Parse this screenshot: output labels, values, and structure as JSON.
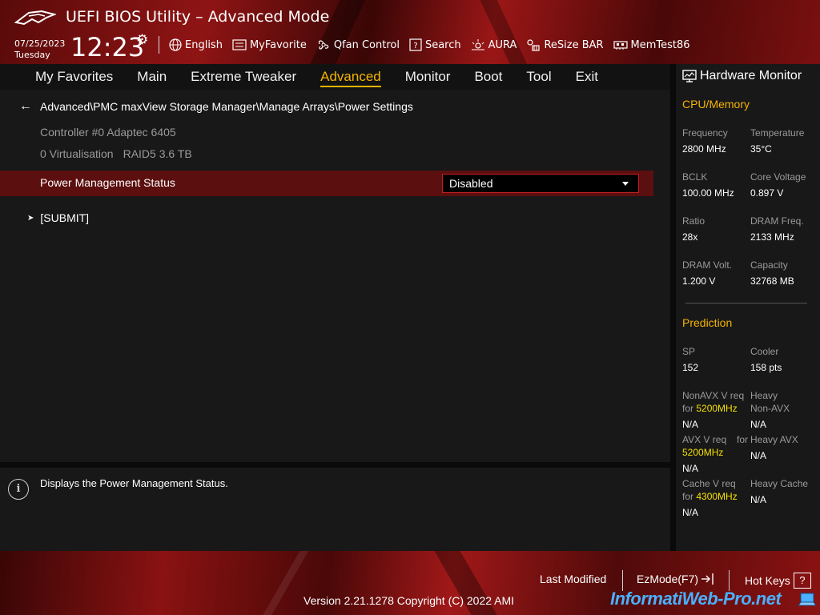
{
  "header": {
    "title": "UEFI BIOS Utility – Advanced Mode",
    "date": "07/25/2023",
    "day": "Tuesday",
    "time": "12:23",
    "tools": [
      {
        "label": "English",
        "icon": "globe-icon"
      },
      {
        "label": "MyFavorite",
        "icon": "favorite-icon"
      },
      {
        "label": "Qfan Control",
        "icon": "fan-icon"
      },
      {
        "label": "Search",
        "icon": "search-icon"
      },
      {
        "label": "AURA",
        "icon": "aura-icon"
      },
      {
        "label": "ReSize BAR",
        "icon": "resize-bar-icon"
      },
      {
        "label": "MemTest86",
        "icon": "memtest-icon"
      }
    ]
  },
  "tabs": [
    {
      "label": "My Favorites"
    },
    {
      "label": "Main"
    },
    {
      "label": "Extreme Tweaker"
    },
    {
      "label": "Advanced",
      "active": true
    },
    {
      "label": "Monitor"
    },
    {
      "label": "Boot"
    },
    {
      "label": "Tool"
    },
    {
      "label": "Exit"
    }
  ],
  "main": {
    "breadcrumb": "Advanced\\PMC maxView Storage Manager\\Manage Arrays\\Power Settings",
    "controller": "Controller #0 Adaptec 6405",
    "array_name": "0 Virtualisation",
    "array_info": "RAID5 3.6 TB",
    "setting_label": "Power Management Status",
    "setting_value": "Disabled",
    "submit_label": "[SUBMIT]"
  },
  "help": {
    "text": "Displays the Power Management Status."
  },
  "hardware_monitor": {
    "title": "Hardware Monitor",
    "cpu_memory_title": "CPU/Memory",
    "frequency_label": "Frequency",
    "frequency": "2800 MHz",
    "temperature_label": "Temperature",
    "temperature": "35°C",
    "bclk_label": "BCLK",
    "bclk": "100.00 MHz",
    "core_voltage_label": "Core Voltage",
    "core_voltage": "0.897 V",
    "ratio_label": "Ratio",
    "ratio": "28x",
    "dram_freq_label": "DRAM Freq.",
    "dram_freq": "2133 MHz",
    "dram_volt_label": "DRAM Volt.",
    "dram_volt": "1.200 V",
    "capacity_label": "Capacity",
    "capacity": "32768 MB",
    "prediction_title": "Prediction",
    "sp_label": "SP",
    "sp": "152",
    "cooler_label": "Cooler",
    "cooler": "158 pts",
    "nonavx_label_1": "NonAVX V req",
    "nonavx_label_2": "for",
    "nonavx_freq": "5200MHz",
    "nonavx_value": "N/A",
    "heavy_nonavx_label_1": "Heavy",
    "heavy_nonavx_label_2": "Non-AVX",
    "heavy_nonavx_value": "N/A",
    "avx_label_1": "AVX V req",
    "avx_label_2": "for",
    "avx_freq": "5200MHz",
    "avx_value": "N/A",
    "heavy_avx_label": "Heavy AVX",
    "heavy_avx_value": "N/A",
    "cache_label_1": "Cache V req",
    "cache_label_2": "for",
    "cache_freq": "4300MHz",
    "cache_value": "N/A",
    "heavy_cache_label": "Heavy Cache",
    "heavy_cache_value": "N/A"
  },
  "footer": {
    "last_modified": "Last Modified",
    "ezmode": "EzMode(F7)",
    "hotkeys": "Hot Keys",
    "hotkeys_key": "?",
    "version": "Version 2.21.1278 Copyright (C) 2022 AMI",
    "watermark": "InformatiWeb-Pro.net"
  },
  "colors": {
    "accent": "#f5b400",
    "selected_row": "#5c0f0f",
    "highlight_value": "#f5e000"
  }
}
